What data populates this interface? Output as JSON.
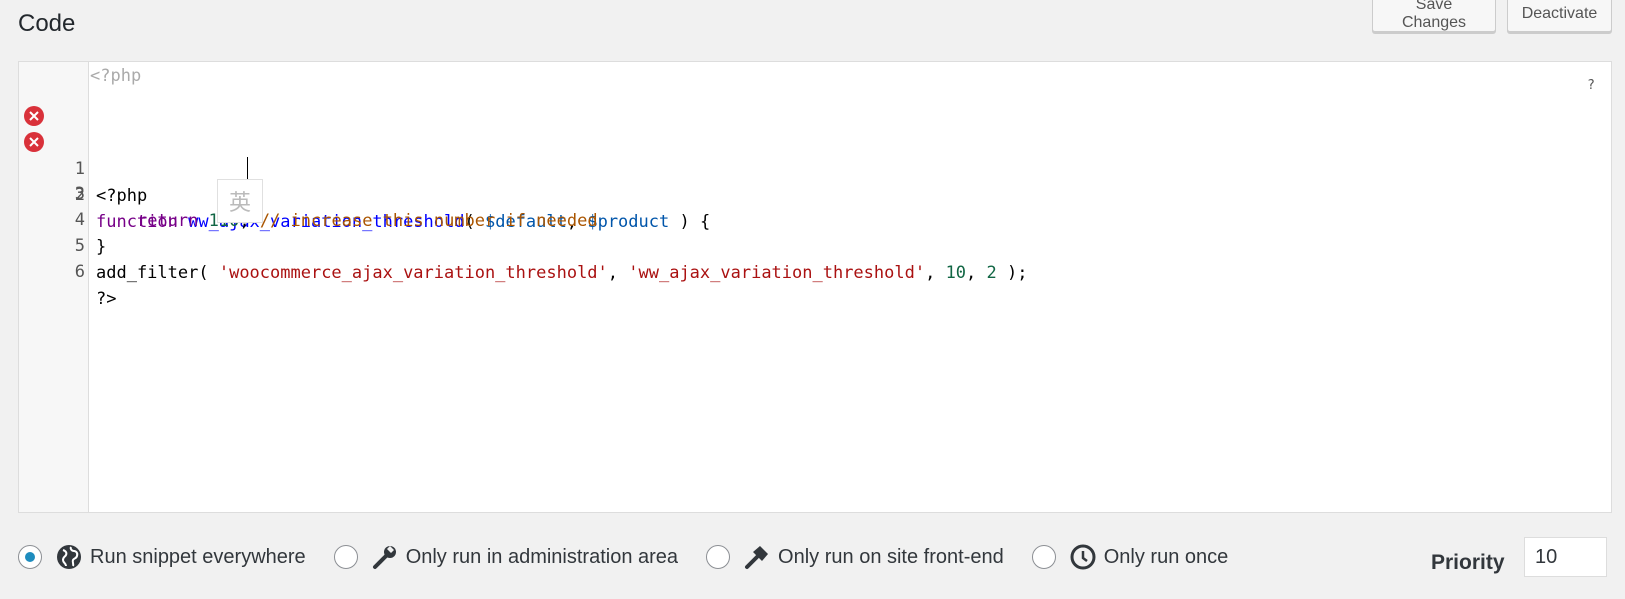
{
  "header": {
    "title": "Code",
    "save_label": "Save Changes",
    "deactivate_label": "Deactivate"
  },
  "editor": {
    "placeholder": "<?php",
    "help": "?",
    "ime_char": "英",
    "lines": [
      {
        "num": "1",
        "error": true
      },
      {
        "num": "2",
        "error": true
      },
      {
        "num": "3",
        "error": false
      },
      {
        "num": "4",
        "error": false
      },
      {
        "num": "5",
        "error": false
      },
      {
        "num": "6",
        "error": false
      }
    ],
    "tokens": {
      "l1": "<?php",
      "l2_kw": "function",
      "l2_fn": "ww_ajax_variation_threshold",
      "l2_open": "( ",
      "l2_v1": "$default",
      "l2_comma": ", ",
      "l2_v2": "$product",
      "l2_close": " ) {",
      "l3_indent": "    ",
      "l3_kw": "return",
      "l3_num": "110",
      "l3_semi": ";",
      "l3_cmt": "// increase this number if needed",
      "l4": "}",
      "l5_fn": "add_filter(",
      "l5_s1": "'woocommerce_ajax_variation_threshold'",
      "l5_c1": ", ",
      "l5_s2": "'ww_ajax_variation_threshold'",
      "l5_c2": ", ",
      "l5_n1": "10",
      "l5_c3": ", ",
      "l5_n2": "2",
      "l5_end": " );",
      "l6": "?>"
    }
  },
  "scope_options": [
    {
      "label": "Run snippet everywhere",
      "icon": "globe-icon",
      "selected": true
    },
    {
      "label": "Only run in administration area",
      "icon": "wrench-icon",
      "selected": false
    },
    {
      "label": "Only run on site front-end",
      "icon": "hammer-icon",
      "selected": false
    },
    {
      "label": "Only run once",
      "icon": "clock-icon",
      "selected": false
    }
  ],
  "priority": {
    "label": "Priority",
    "value": "10"
  },
  "colors": {
    "accent": "#1e8cbe",
    "error": "#d9313a",
    "keyword": "#770088",
    "string": "#aa1111",
    "comment": "#aa5500",
    "number": "#116644"
  }
}
